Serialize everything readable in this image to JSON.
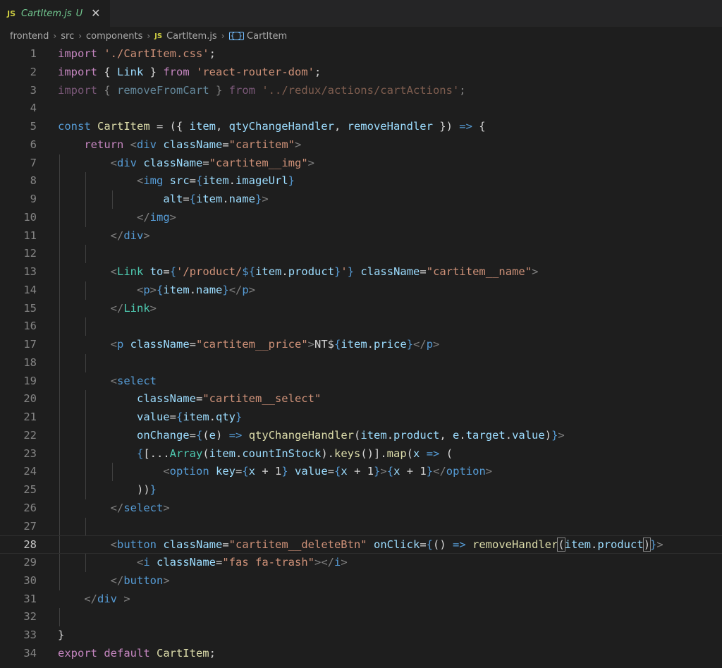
{
  "tab": {
    "badge": "JS",
    "filename": "CartItem.js",
    "status": "U",
    "close": "✕"
  },
  "breadcrumb": {
    "items": [
      "frontend",
      "src",
      "components",
      "CartItem.js",
      "CartItem"
    ],
    "js_badge": "JS",
    "symbol_glyph": "{ }"
  },
  "current_line": 28,
  "lines": [
    {
      "n": "1",
      "t": [
        [
          "kw",
          "import "
        ],
        [
          "str",
          "'./CartItem.css'"
        ],
        [
          "plain",
          ";"
        ]
      ]
    },
    {
      "n": "2",
      "t": [
        [
          "kw",
          "import "
        ],
        [
          "plain",
          "{ "
        ],
        [
          "var",
          "Link"
        ],
        [
          "plain",
          " } "
        ],
        [
          "kw",
          "from "
        ],
        [
          "str",
          "'react-router-dom'"
        ],
        [
          "plain",
          ";"
        ]
      ]
    },
    {
      "n": "3",
      "dim": true,
      "t": [
        [
          "kw",
          "import "
        ],
        [
          "plain",
          "{ "
        ],
        [
          "var",
          "removeFromCart"
        ],
        [
          "plain",
          " } "
        ],
        [
          "kw",
          "from "
        ],
        [
          "str",
          "'../redux/actions/cartActions'"
        ],
        [
          "plain",
          ";"
        ]
      ]
    },
    {
      "n": "4",
      "t": []
    },
    {
      "n": "5",
      "t": [
        [
          "kwd",
          "const "
        ],
        [
          "fn",
          "CartItem"
        ],
        [
          "plain",
          " = ({ "
        ],
        [
          "var",
          "item"
        ],
        [
          "plain",
          ", "
        ],
        [
          "var",
          "qtyChangeHandler"
        ],
        [
          "plain",
          ", "
        ],
        [
          "var",
          "removeHandler"
        ],
        [
          "plain",
          " }) "
        ],
        [
          "kwd",
          "=>"
        ],
        [
          "plain",
          " {"
        ]
      ]
    },
    {
      "n": "6",
      "t": [
        [
          "plain",
          "    "
        ],
        [
          "kw",
          "return "
        ],
        [
          "pun",
          "<"
        ],
        [
          "tag",
          "div "
        ],
        [
          "attr",
          "className"
        ],
        [
          "plain",
          "="
        ],
        [
          "str",
          "\"cartitem\""
        ],
        [
          "pun",
          ">"
        ]
      ]
    },
    {
      "n": "7",
      "t": [
        [
          "plain",
          "        "
        ],
        [
          "pun",
          "<"
        ],
        [
          "tag",
          "div "
        ],
        [
          "attr",
          "className"
        ],
        [
          "plain",
          "="
        ],
        [
          "str",
          "\"cartitem__img\""
        ],
        [
          "pun",
          ">"
        ]
      ]
    },
    {
      "n": "8",
      "t": [
        [
          "plain",
          "            "
        ],
        [
          "pun",
          "<"
        ],
        [
          "tag",
          "img "
        ],
        [
          "attr",
          "src"
        ],
        [
          "plain",
          "="
        ],
        [
          "kwd",
          "{"
        ],
        [
          "var",
          "item"
        ],
        [
          "plain",
          "."
        ],
        [
          "var",
          "imageUrl"
        ],
        [
          "kwd",
          "}"
        ]
      ]
    },
    {
      "n": "9",
      "t": [
        [
          "plain",
          "                "
        ],
        [
          "attr",
          "alt"
        ],
        [
          "plain",
          "="
        ],
        [
          "kwd",
          "{"
        ],
        [
          "var",
          "item"
        ],
        [
          "plain",
          "."
        ],
        [
          "var",
          "name"
        ],
        [
          "kwd",
          "}"
        ],
        [
          "pun",
          ">"
        ]
      ]
    },
    {
      "n": "10",
      "t": [
        [
          "plain",
          "            "
        ],
        [
          "pun",
          "</"
        ],
        [
          "tag",
          "img"
        ],
        [
          "pun",
          ">"
        ]
      ]
    },
    {
      "n": "11",
      "t": [
        [
          "plain",
          "        "
        ],
        [
          "pun",
          "</"
        ],
        [
          "tag",
          "div"
        ],
        [
          "pun",
          ">"
        ]
      ]
    },
    {
      "n": "12",
      "t": []
    },
    {
      "n": "13",
      "t": [
        [
          "plain",
          "        "
        ],
        [
          "pun",
          "<"
        ],
        [
          "comp",
          "Link "
        ],
        [
          "attr",
          "to"
        ],
        [
          "plain",
          "="
        ],
        [
          "kwd",
          "{"
        ],
        [
          "str",
          "'/product/"
        ],
        [
          "kwd",
          "${"
        ],
        [
          "var",
          "item"
        ],
        [
          "plain",
          "."
        ],
        [
          "var",
          "product"
        ],
        [
          "kwd",
          "}"
        ],
        [
          "str",
          "'"
        ],
        [
          "kwd",
          "}"
        ],
        [
          "plain",
          " "
        ],
        [
          "attr",
          "className"
        ],
        [
          "plain",
          "="
        ],
        [
          "str",
          "\"cartitem__name\""
        ],
        [
          "pun",
          ">"
        ]
      ]
    },
    {
      "n": "14",
      "t": [
        [
          "plain",
          "            "
        ],
        [
          "pun",
          "<"
        ],
        [
          "tag",
          "p"
        ],
        [
          "pun",
          ">"
        ],
        [
          "kwd",
          "{"
        ],
        [
          "var",
          "item"
        ],
        [
          "plain",
          "."
        ],
        [
          "var",
          "name"
        ],
        [
          "kwd",
          "}"
        ],
        [
          "pun",
          "</"
        ],
        [
          "tag",
          "p"
        ],
        [
          "pun",
          ">"
        ]
      ]
    },
    {
      "n": "15",
      "t": [
        [
          "plain",
          "        "
        ],
        [
          "pun",
          "</"
        ],
        [
          "comp",
          "Link"
        ],
        [
          "pun",
          ">"
        ]
      ]
    },
    {
      "n": "16",
      "t": []
    },
    {
      "n": "17",
      "t": [
        [
          "plain",
          "        "
        ],
        [
          "pun",
          "<"
        ],
        [
          "tag",
          "p "
        ],
        [
          "attr",
          "className"
        ],
        [
          "plain",
          "="
        ],
        [
          "str",
          "\"cartitem__price\""
        ],
        [
          "pun",
          ">"
        ],
        [
          "plain",
          "NT$"
        ],
        [
          "kwd",
          "{"
        ],
        [
          "var",
          "item"
        ],
        [
          "plain",
          "."
        ],
        [
          "var",
          "price"
        ],
        [
          "kwd",
          "}"
        ],
        [
          "pun",
          "</"
        ],
        [
          "tag",
          "p"
        ],
        [
          "pun",
          ">"
        ]
      ]
    },
    {
      "n": "18",
      "t": []
    },
    {
      "n": "19",
      "t": [
        [
          "plain",
          "        "
        ],
        [
          "pun",
          "<"
        ],
        [
          "tag",
          "select"
        ]
      ]
    },
    {
      "n": "20",
      "t": [
        [
          "plain",
          "            "
        ],
        [
          "attr",
          "className"
        ],
        [
          "plain",
          "="
        ],
        [
          "str",
          "\"cartitem__select\""
        ]
      ]
    },
    {
      "n": "21",
      "t": [
        [
          "plain",
          "            "
        ],
        [
          "attr",
          "value"
        ],
        [
          "plain",
          "="
        ],
        [
          "kwd",
          "{"
        ],
        [
          "var",
          "item"
        ],
        [
          "plain",
          "."
        ],
        [
          "var",
          "qty"
        ],
        [
          "kwd",
          "}"
        ]
      ]
    },
    {
      "n": "22",
      "t": [
        [
          "plain",
          "            "
        ],
        [
          "attr",
          "onChange"
        ],
        [
          "plain",
          "="
        ],
        [
          "kwd",
          "{"
        ],
        [
          "plain",
          "("
        ],
        [
          "var",
          "e"
        ],
        [
          "plain",
          ") "
        ],
        [
          "kwd",
          "=>"
        ],
        [
          "plain",
          " "
        ],
        [
          "fn",
          "qtyChangeHandler"
        ],
        [
          "plain",
          "("
        ],
        [
          "var",
          "item"
        ],
        [
          "plain",
          "."
        ],
        [
          "var",
          "product"
        ],
        [
          "plain",
          ", "
        ],
        [
          "var",
          "e"
        ],
        [
          "plain",
          "."
        ],
        [
          "var",
          "target"
        ],
        [
          "plain",
          "."
        ],
        [
          "var",
          "value"
        ],
        [
          "plain",
          ")"
        ],
        [
          "kwd",
          "}"
        ],
        [
          "pun",
          ">"
        ]
      ]
    },
    {
      "n": "23",
      "t": [
        [
          "plain",
          "            "
        ],
        [
          "kwd",
          "{"
        ],
        [
          "plain",
          "[..."
        ],
        [
          "comp",
          "Array"
        ],
        [
          "plain",
          "("
        ],
        [
          "var",
          "item"
        ],
        [
          "plain",
          "."
        ],
        [
          "var",
          "countInStock"
        ],
        [
          "plain",
          ")."
        ],
        [
          "fn",
          "keys"
        ],
        [
          "plain",
          "()]."
        ],
        [
          "fn",
          "map"
        ],
        [
          "plain",
          "("
        ],
        [
          "var",
          "x"
        ],
        [
          "plain",
          " "
        ],
        [
          "kwd",
          "=>"
        ],
        [
          "plain",
          " ("
        ]
      ]
    },
    {
      "n": "24",
      "t": [
        [
          "plain",
          "                "
        ],
        [
          "pun",
          "<"
        ],
        [
          "tag",
          "option "
        ],
        [
          "attr",
          "key"
        ],
        [
          "plain",
          "="
        ],
        [
          "kwd",
          "{"
        ],
        [
          "var",
          "x"
        ],
        [
          "plain",
          " + 1"
        ],
        [
          "kwd",
          "}"
        ],
        [
          "plain",
          " "
        ],
        [
          "attr",
          "value"
        ],
        [
          "plain",
          "="
        ],
        [
          "kwd",
          "{"
        ],
        [
          "var",
          "x"
        ],
        [
          "plain",
          " + 1"
        ],
        [
          "kwd",
          "}"
        ],
        [
          "pun",
          ">"
        ],
        [
          "kwd",
          "{"
        ],
        [
          "var",
          "x"
        ],
        [
          "plain",
          " + 1"
        ],
        [
          "kwd",
          "}"
        ],
        [
          "pun",
          "</"
        ],
        [
          "tag",
          "option"
        ],
        [
          "pun",
          ">"
        ]
      ]
    },
    {
      "n": "25",
      "t": [
        [
          "plain",
          "            ))"
        ],
        [
          "kwd",
          "}"
        ]
      ]
    },
    {
      "n": "26",
      "t": [
        [
          "plain",
          "        "
        ],
        [
          "pun",
          "</"
        ],
        [
          "tag",
          "select"
        ],
        [
          "pun",
          ">"
        ]
      ]
    },
    {
      "n": "27",
      "t": []
    },
    {
      "n": "28",
      "t": [
        [
          "plain",
          "        "
        ],
        [
          "pun",
          "<"
        ],
        [
          "tag",
          "button "
        ],
        [
          "attr",
          "className"
        ],
        [
          "plain",
          "="
        ],
        [
          "str",
          "\"cartitem__deleteBtn\""
        ],
        [
          "plain",
          " "
        ],
        [
          "attr",
          "onClick"
        ],
        [
          "plain",
          "="
        ],
        [
          "kwd",
          "{"
        ],
        [
          "plain",
          "() "
        ],
        [
          "kwd",
          "=>"
        ],
        [
          "plain",
          " "
        ],
        [
          "fn",
          "removeHandler"
        ],
        [
          "bm",
          "("
        ],
        [
          "var",
          "item"
        ],
        [
          "plain",
          "."
        ],
        [
          "var",
          "product"
        ],
        [
          "bm",
          ")"
        ],
        [
          "kwd",
          "}"
        ],
        [
          "pun",
          ">"
        ]
      ]
    },
    {
      "n": "29",
      "t": [
        [
          "plain",
          "            "
        ],
        [
          "pun",
          "<"
        ],
        [
          "tag",
          "i "
        ],
        [
          "attr",
          "className"
        ],
        [
          "plain",
          "="
        ],
        [
          "str",
          "\"fas fa-trash\""
        ],
        [
          "pun",
          "></"
        ],
        [
          "tag",
          "i"
        ],
        [
          "pun",
          ">"
        ]
      ]
    },
    {
      "n": "30",
      "t": [
        [
          "plain",
          "        "
        ],
        [
          "pun",
          "</"
        ],
        [
          "tag",
          "button"
        ],
        [
          "pun",
          ">"
        ]
      ]
    },
    {
      "n": "31",
      "t": [
        [
          "plain",
          "    "
        ],
        [
          "pun",
          "</"
        ],
        [
          "tag",
          "div"
        ],
        [
          "plain",
          " "
        ],
        [
          "pun",
          ">"
        ]
      ]
    },
    {
      "n": "32",
      "t": []
    },
    {
      "n": "33",
      "t": [
        [
          "plain",
          "}"
        ]
      ]
    },
    {
      "n": "34",
      "t": [
        [
          "kw",
          "export "
        ],
        [
          "kw",
          "default "
        ],
        [
          "fn",
          "CartItem"
        ],
        [
          "plain",
          ";"
        ]
      ]
    }
  ],
  "colors": {
    "background": "#1e1e1e",
    "keyword": "#c586c0",
    "storage": "#569cd6",
    "string": "#ce9178",
    "component": "#4ec9b0",
    "attribute": "#9cdcfe",
    "function": "#dcdcaa"
  }
}
